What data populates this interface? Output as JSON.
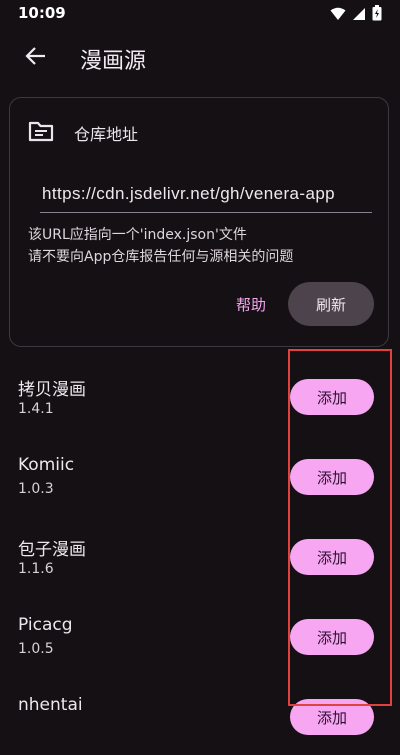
{
  "status_bar": {
    "time": "10:09"
  },
  "app_bar": {
    "title": "漫画源"
  },
  "repo_card": {
    "header_label": "仓库地址",
    "url_value": "https://cdn.jsdelivr.net/gh/venera-app",
    "hint_line1": "该URL应指向一个'index.json'文件",
    "hint_line2": "请不要向App仓库报告任何与源相关的问题",
    "help_label": "帮助",
    "refresh_label": "刷新"
  },
  "sources": [
    {
      "name": "拷贝漫画",
      "version": "1.4.1",
      "action": "添加"
    },
    {
      "name": "Komiic",
      "version": "1.0.3",
      "action": "添加"
    },
    {
      "name": "包子漫画",
      "version": "1.1.6",
      "action": "添加"
    },
    {
      "name": "Picacg",
      "version": "1.0.5",
      "action": "添加"
    },
    {
      "name": "nhentai",
      "version": "",
      "action": "添加"
    }
  ],
  "colors": {
    "background": "#141013",
    "accent_pink": "#f7a6f2",
    "highlight_red": "#e0433f"
  },
  "icons": [
    "wifi-icon",
    "signal-icon",
    "battery-icon",
    "back-arrow-icon",
    "folder-icon"
  ]
}
